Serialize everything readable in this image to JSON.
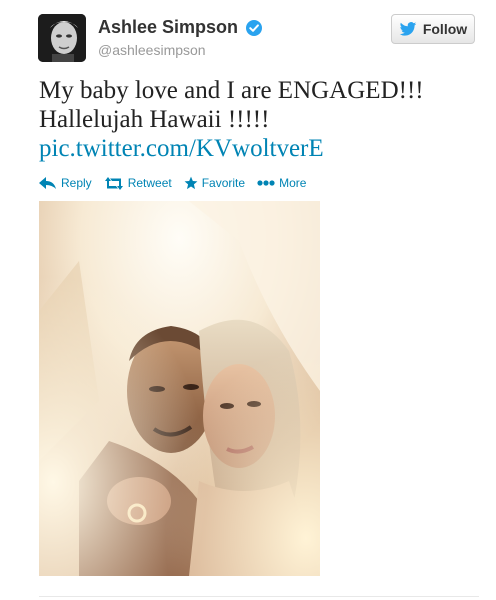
{
  "user": {
    "display_name": "Ashlee Simpson",
    "screen_name": "@ashleesimpson",
    "avatar_icon": "avatar-photo",
    "verified_icon": "verified-badge-icon"
  },
  "follow_button": {
    "label": "Follow",
    "icon": "twitter-bird-icon"
  },
  "tweet": {
    "line1": "My baby love and I are ENGAGED!!!",
    "line2": "Hallelujah Hawaii !!!!!",
    "link": "pic.twitter.com/KVwoltverE"
  },
  "actions": [
    {
      "label": "Reply",
      "icon": "reply-icon"
    },
    {
      "label": "Retweet",
      "icon": "retweet-icon"
    },
    {
      "label": "Favorite",
      "icon": "star-icon"
    },
    {
      "label": "More",
      "icon": "more-dots-icon"
    }
  ],
  "colors": {
    "link": "#0084b4",
    "verified": "#2aa3ef",
    "text": "#333333",
    "secondary": "#999999"
  }
}
